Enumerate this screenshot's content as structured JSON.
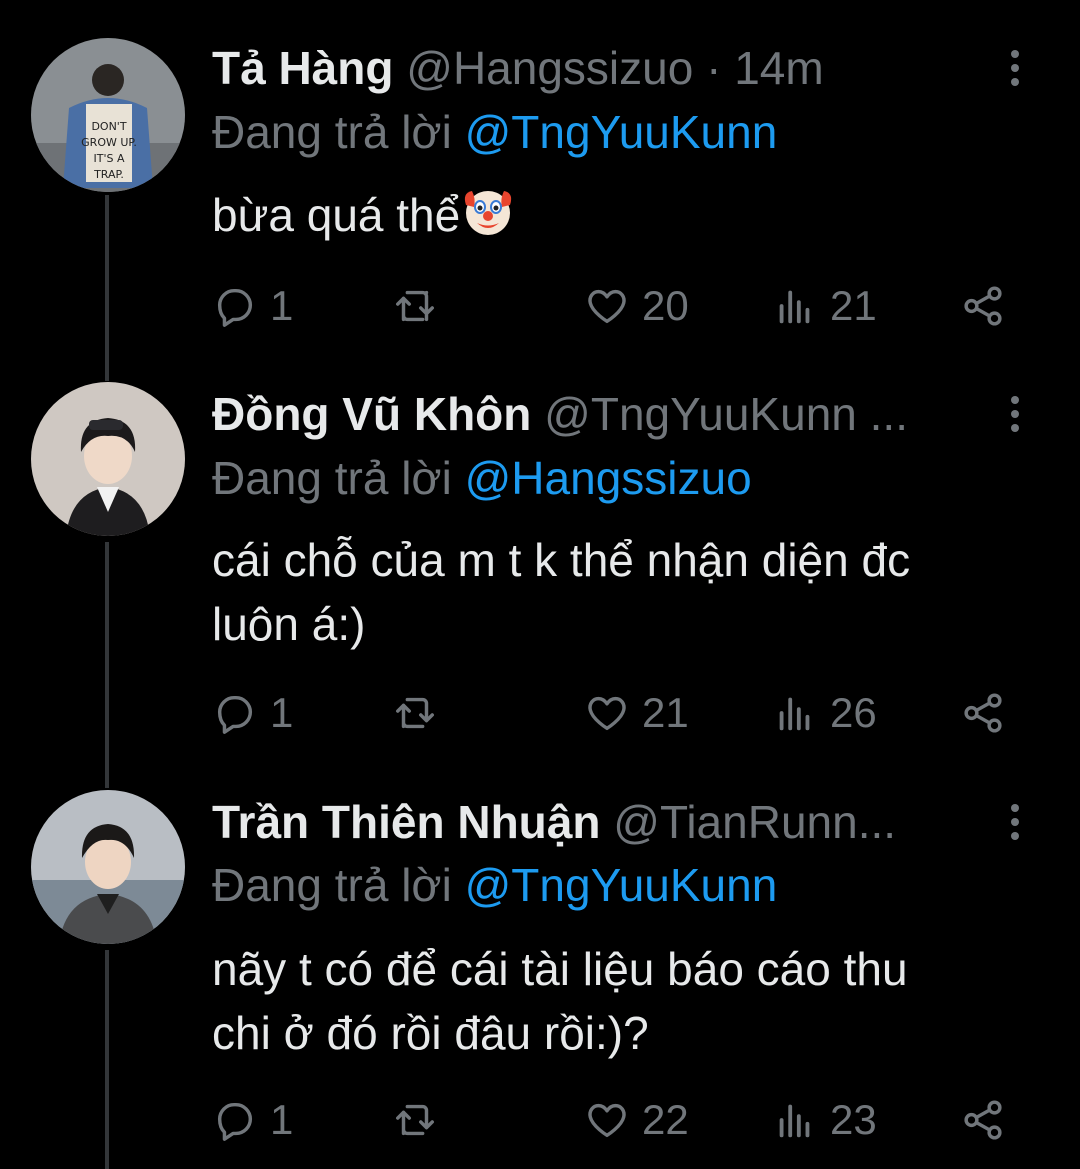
{
  "tweets": [
    {
      "name": "Tả Hàng",
      "handle": "@Hangssizuo",
      "time": "· 14m",
      "replying_prefix": "Đang trả lời",
      "replying_to": "@TngYuuKunn",
      "text_lines": [
        "bừa quá thể"
      ],
      "emoji": "clown-face",
      "replies": "1",
      "retweets": "",
      "likes": "20",
      "views": "21"
    },
    {
      "name": "Đồng Vũ Khôn",
      "handle": "@TngYuuKunn ...",
      "time": "",
      "replying_prefix": "Đang trả lời",
      "replying_to": "@Hangssizuo",
      "text_lines": [
        "cái chỗ của m t k thể nhận diện đc",
        "luôn á:)"
      ],
      "emoji": "",
      "replies": "1",
      "retweets": "",
      "likes": "21",
      "views": "26"
    },
    {
      "name": "Trần Thiên Nhuận",
      "handle": "@TianRunn...",
      "time": "",
      "replying_prefix": "Đang trả lời",
      "replying_to": "@TngYuuKunn",
      "text_lines": [
        "nãy t có để cái tài liệu báo cáo thu",
        "chi ở đó rồi đâu rồi:)?"
      ],
      "emoji": "",
      "replies": "1",
      "retweets": "",
      "likes": "22",
      "views": "23"
    }
  ],
  "colors": {
    "background": "#000000",
    "text": "#e7e9ea",
    "muted": "#71767b",
    "mention": "#1d9bf0",
    "thread_line": "#333639"
  },
  "icons": [
    "reply-icon",
    "retweet-icon",
    "like-icon",
    "views-icon",
    "share-icon",
    "more-icon",
    "clown-face-emoji"
  ]
}
